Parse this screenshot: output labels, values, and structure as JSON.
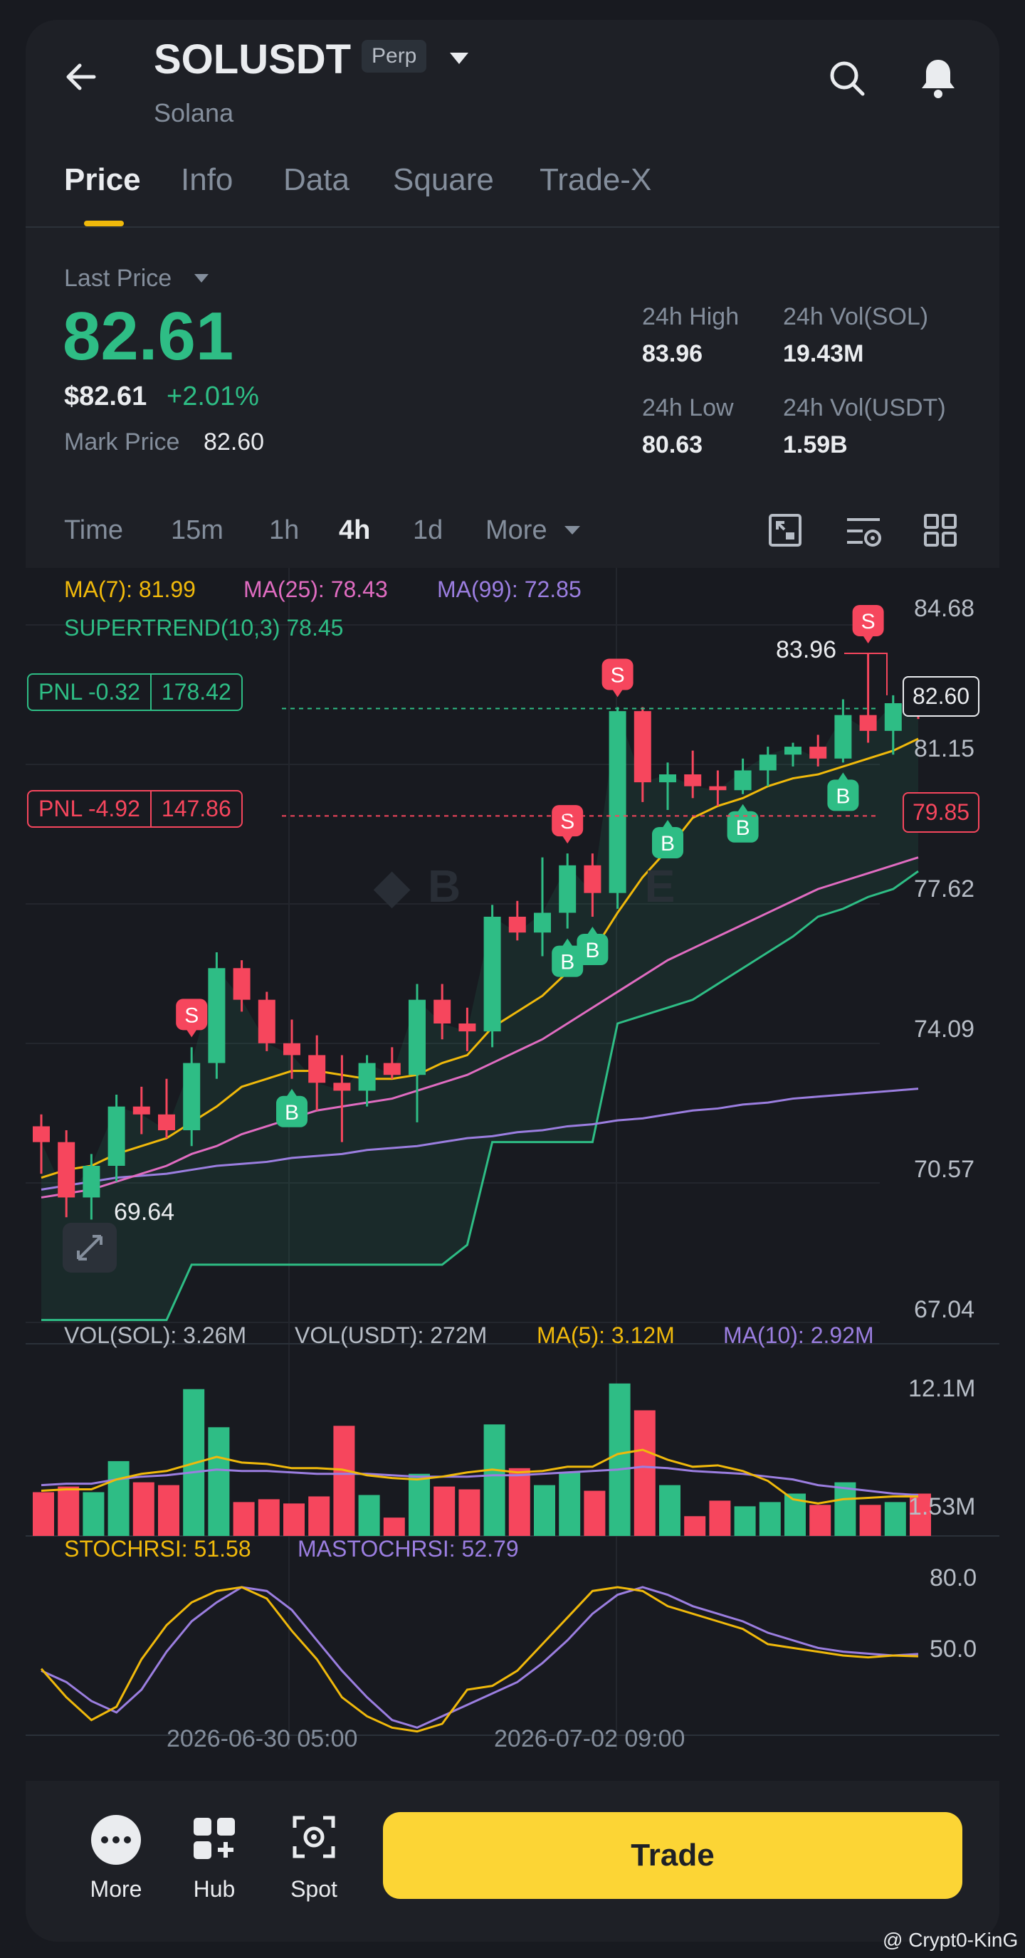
{
  "header": {
    "symbol": "SOLUSDT",
    "badge": "Perp",
    "name": "Solana"
  },
  "tabs": [
    "Price",
    "Info",
    "Data",
    "Square",
    "Trade-X"
  ],
  "stats": {
    "last_price_label": "Last Price",
    "last_price": "82.61",
    "usd_price": "$82.61",
    "change": "+2.01%",
    "mark_label": "Mark Price",
    "mark_value": "82.60",
    "high_label": "24h High",
    "high": "83.96",
    "low_label": "24h Low",
    "low": "80.63",
    "vol_sol_label": "24h Vol(SOL)",
    "vol_sol": "19.43M",
    "vol_usdt_label": "24h Vol(USDT)",
    "vol_usdt": "1.59B"
  },
  "timeframes": [
    "Time",
    "15m",
    "1h",
    "4h",
    "1d",
    "More"
  ],
  "indicators": {
    "ma7": "MA(7): 81.99",
    "ma25": "MA(25): 78.43",
    "ma99": "MA(99): 72.85",
    "supertrend": "SUPERTREND(10,3) 78.45"
  },
  "pnl": [
    {
      "label": "PNL -0.32",
      "value": "178.42"
    },
    {
      "label": "PNL -4.92",
      "value": "147.86"
    }
  ],
  "price_tags": {
    "current": "82.60",
    "liq": "79.85",
    "high_mark": "83.96",
    "low_mark": "69.64"
  },
  "chart_data": {
    "type": "candlestick",
    "y_axis": [
      "84.68",
      "81.15",
      "77.62",
      "74.09",
      "70.57",
      "67.04"
    ],
    "ylim": [
      67.04,
      84.68
    ],
    "candles": [
      [
        72.0,
        72.3,
        70.8,
        71.6
      ],
      [
        71.6,
        71.9,
        69.7,
        70.2
      ],
      [
        70.2,
        71.3,
        69.64,
        71.0
      ],
      [
        71.0,
        72.8,
        70.6,
        72.5
      ],
      [
        72.5,
        73.0,
        71.8,
        72.3
      ],
      [
        72.3,
        73.2,
        71.7,
        71.9
      ],
      [
        71.9,
        74.0,
        71.5,
        73.6
      ],
      [
        73.6,
        76.4,
        73.2,
        76.0
      ],
      [
        76.0,
        76.2,
        74.9,
        75.2
      ],
      [
        75.2,
        75.4,
        73.9,
        74.1
      ],
      [
        74.1,
        74.7,
        73.2,
        73.8
      ],
      [
        73.8,
        74.3,
        72.4,
        73.1
      ],
      [
        73.1,
        73.8,
        71.6,
        72.9
      ],
      [
        72.9,
        73.8,
        72.5,
        73.6
      ],
      [
        73.6,
        74.0,
        73.2,
        73.3
      ],
      [
        73.3,
        75.6,
        72.1,
        75.2
      ],
      [
        75.2,
        75.6,
        74.2,
        74.6
      ],
      [
        74.6,
        75.0,
        73.9,
        74.4
      ],
      [
        74.4,
        77.6,
        74.0,
        77.3
      ],
      [
        77.3,
        77.7,
        76.7,
        76.9
      ],
      [
        76.9,
        78.8,
        76.3,
        77.4
      ],
      [
        77.4,
        78.9,
        77.0,
        78.6
      ],
      [
        78.6,
        78.9,
        77.3,
        77.9
      ],
      [
        77.9,
        82.6,
        77.5,
        82.5
      ],
      [
        82.5,
        82.6,
        80.2,
        80.7
      ],
      [
        80.7,
        81.2,
        80.0,
        80.9
      ],
      [
        80.9,
        81.5,
        80.3,
        80.6
      ],
      [
        80.6,
        81.0,
        80.1,
        80.5
      ],
      [
        80.5,
        81.3,
        80.4,
        81.0
      ],
      [
        81.0,
        81.6,
        80.6,
        81.4
      ],
      [
        81.4,
        81.7,
        81.1,
        81.6
      ],
      [
        81.6,
        81.9,
        81.1,
        81.3
      ],
      [
        81.3,
        82.8,
        81.2,
        82.4
      ],
      [
        82.4,
        83.96,
        81.7,
        82.0
      ],
      [
        82.0,
        82.9,
        81.4,
        82.7
      ],
      [
        82.7,
        82.9,
        82.3,
        82.6
      ]
    ],
    "ma7": [
      70.7,
      70.9,
      71.0,
      71.3,
      71.5,
      71.7,
      72.1,
      72.5,
      73.0,
      73.2,
      73.4,
      73.4,
      73.3,
      73.2,
      73.2,
      73.3,
      73.6,
      73.8,
      74.5,
      74.9,
      75.3,
      75.9,
      76.4,
      77.4,
      78.3,
      79.0,
      79.8,
      80.1,
      80.3,
      80.6,
      80.8,
      80.9,
      81.1,
      81.3,
      81.5,
      81.8
    ],
    "ma25": [
      70.2,
      70.3,
      70.4,
      70.6,
      70.8,
      71.0,
      71.3,
      71.5,
      71.8,
      72.0,
      72.2,
      72.4,
      72.5,
      72.6,
      72.7,
      72.9,
      73.1,
      73.3,
      73.6,
      73.9,
      74.2,
      74.6,
      75.0,
      75.4,
      75.8,
      76.2,
      76.5,
      76.8,
      77.1,
      77.4,
      77.7,
      78.0,
      78.2,
      78.4,
      78.6,
      78.8
    ],
    "ma99": [
      70.4,
      70.5,
      70.6,
      70.7,
      70.75,
      70.8,
      70.9,
      71.0,
      71.05,
      71.1,
      71.2,
      71.25,
      71.3,
      71.4,
      71.45,
      71.5,
      71.6,
      71.7,
      71.75,
      71.85,
      71.9,
      72.0,
      72.05,
      72.15,
      72.2,
      72.3,
      72.4,
      72.45,
      72.55,
      72.6,
      72.7,
      72.75,
      72.8,
      72.85,
      72.9,
      72.95
    ],
    "supertrend": [
      67.1,
      67.1,
      67.1,
      67.1,
      67.1,
      67.1,
      68.5,
      68.5,
      68.5,
      68.5,
      68.5,
      68.5,
      68.5,
      68.5,
      68.5,
      68.5,
      68.5,
      69.0,
      71.6,
      71.6,
      71.6,
      71.6,
      71.6,
      74.6,
      74.8,
      75.0,
      75.2,
      75.6,
      76.0,
      76.4,
      76.8,
      77.3,
      77.5,
      77.8,
      78.0,
      78.45
    ],
    "signals": [
      {
        "i": 6,
        "type": "S"
      },
      {
        "i": 10,
        "type": "B"
      },
      {
        "i": 21,
        "type": "S"
      },
      {
        "i": 21,
        "type": "B"
      },
      {
        "i": 22,
        "type": "B"
      },
      {
        "i": 23,
        "type": "S"
      },
      {
        "i": 25,
        "type": "B"
      },
      {
        "i": 28,
        "type": "B"
      },
      {
        "i": 32,
        "type": "B"
      },
      {
        "i": 33,
        "type": "S"
      }
    ],
    "volume": {
      "label_sol": "VOL(SOL): 3.26M",
      "label_usdt": "VOL(USDT): 272M",
      "label_ma5": "MA(5): 3.12M",
      "label_ma10": "MA(10): 2.92M",
      "y_axis": [
        "12.1M",
        "1.53M"
      ],
      "values": [
        3.1,
        3.5,
        3.1,
        5.3,
        3.8,
        3.6,
        10.4,
        7.7,
        2.4,
        2.6,
        2.3,
        2.8,
        7.8,
        2.9,
        1.3,
        4.4,
        3.5,
        3.3,
        7.9,
        4.8,
        3.6,
        4.5,
        3.2,
        10.8,
        8.9,
        3.6,
        1.4,
        2.5,
        2.1,
        2.4,
        3.0,
        2.2,
        3.8,
        2.2,
        2.4,
        3.0
      ],
      "ma5": [
        3.2,
        3.3,
        3.3,
        4.0,
        4.4,
        4.6,
        5.1,
        5.6,
        5.2,
        5.1,
        4.8,
        4.8,
        4.7,
        4.3,
        4.1,
        4.0,
        4.2,
        4.5,
        4.7,
        4.5,
        4.6,
        4.9,
        4.9,
        5.8,
        6.1,
        5.4,
        4.9,
        5.0,
        4.6,
        3.9,
        2.6,
        2.3,
        2.6,
        2.7,
        2.8,
        2.8
      ],
      "ma10": [
        3.6,
        3.7,
        3.7,
        4.0,
        4.2,
        4.3,
        4.5,
        4.7,
        4.6,
        4.6,
        4.5,
        4.4,
        4.4,
        4.4,
        4.3,
        4.2,
        4.2,
        4.2,
        4.3,
        4.3,
        4.4,
        4.5,
        4.6,
        4.7,
        4.9,
        4.8,
        4.6,
        4.5,
        4.4,
        4.2,
        4.0,
        3.6,
        3.4,
        3.2,
        3.0,
        2.9
      ]
    },
    "stochrsi": {
      "label": "STOCHRSI: 51.58",
      "label_ma": "MASTOCHRSI: 52.79",
      "y_axis": [
        "80.0",
        "50.0"
      ],
      "ylim": [
        10,
        100
      ],
      "k": [
        45,
        30,
        18,
        25,
        50,
        68,
        80,
        86,
        88,
        82,
        65,
        50,
        30,
        20,
        14,
        12,
        16,
        34,
        36,
        44,
        58,
        72,
        86,
        88,
        86,
        78,
        74,
        70,
        66,
        58,
        56,
        54,
        52,
        51,
        52,
        51.58
      ],
      "d": [
        44,
        38,
        28,
        22,
        34,
        54,
        70,
        80,
        88,
        86,
        76,
        60,
        44,
        30,
        18,
        14,
        20,
        26,
        32,
        38,
        48,
        60,
        74,
        84,
        88,
        84,
        78,
        74,
        70,
        64,
        60,
        56,
        54,
        53,
        52,
        52.79
      ]
    },
    "x_labels": [
      "2026-06-30 05:00",
      "2026-07-02 09:00"
    ]
  },
  "bottom_nav": {
    "more": "More",
    "hub": "Hub",
    "spot": "Spot",
    "trade": "Trade"
  },
  "watermark": "@ Crypt0-KinG",
  "colors": {
    "up": "#2ebd85",
    "down": "#f6465d",
    "accent": "#f0b90b",
    "bg": "#1e2026"
  }
}
